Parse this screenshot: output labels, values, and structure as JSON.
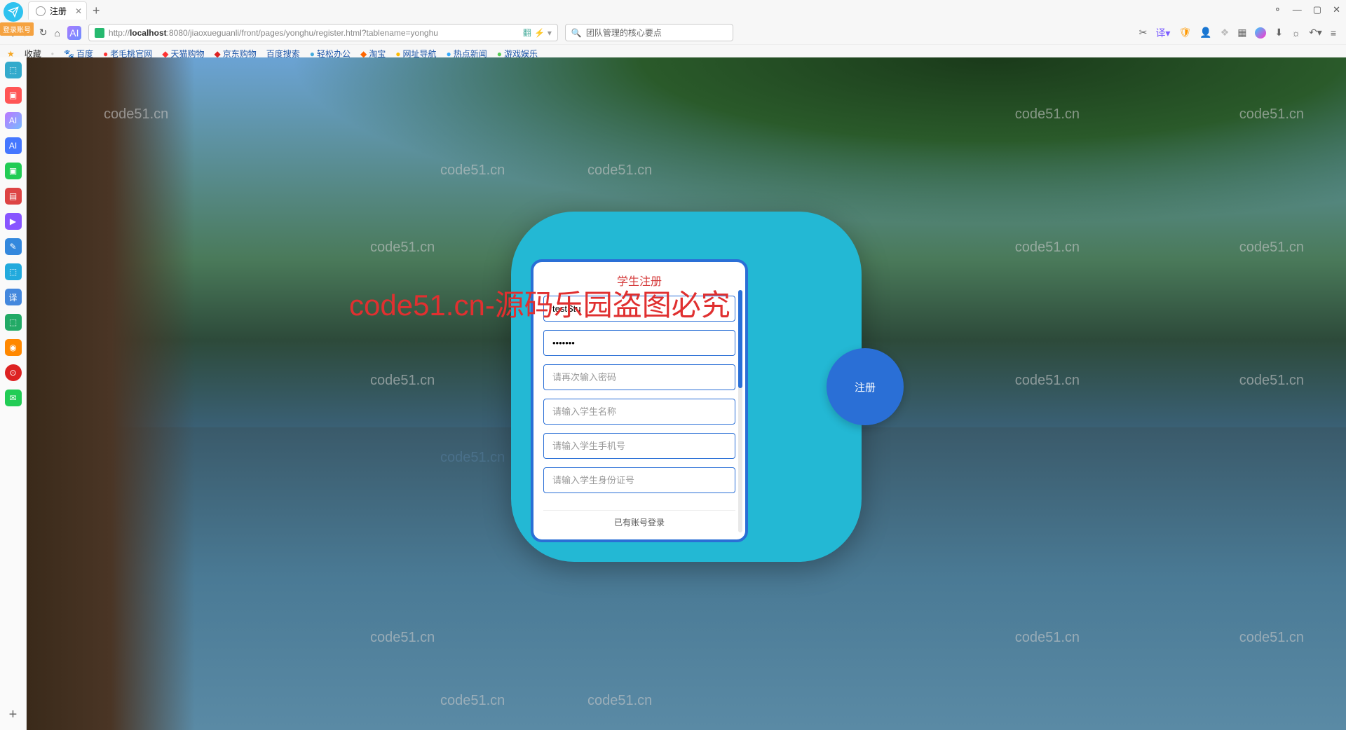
{
  "window": {
    "tab_title": "注册",
    "login_badge": "登录账号"
  },
  "nav": {
    "url_prefix": "http://",
    "url_host": "localhost",
    "url_rest": ":8080/jiaoxueguanli/front/pages/yonghu/register.html?tablename=yonghu",
    "search_placeholder": "团队管理的核心要点"
  },
  "bookmarks": {
    "fav": "收藏",
    "items": [
      "百度",
      "老毛桃官网",
      "天猫购物",
      "京东购物",
      "百度搜索",
      "轻松办公",
      "淘宝",
      "网址导航",
      "热点新闻",
      "游戏娱乐"
    ]
  },
  "form": {
    "title": "学生注册",
    "username_value": "testStu",
    "password_value": "•••••••",
    "confirm_placeholder": "请再次输入密码",
    "name_placeholder": "请输入学生名称",
    "phone_placeholder": "请输入学生手机号",
    "idcard_placeholder": "请输入学生身份证号",
    "submit": "注册",
    "login_link": "已有账号登录"
  },
  "watermark": {
    "small": "code51.cn",
    "red": "code51.cn-源码乐园盗图必究"
  }
}
